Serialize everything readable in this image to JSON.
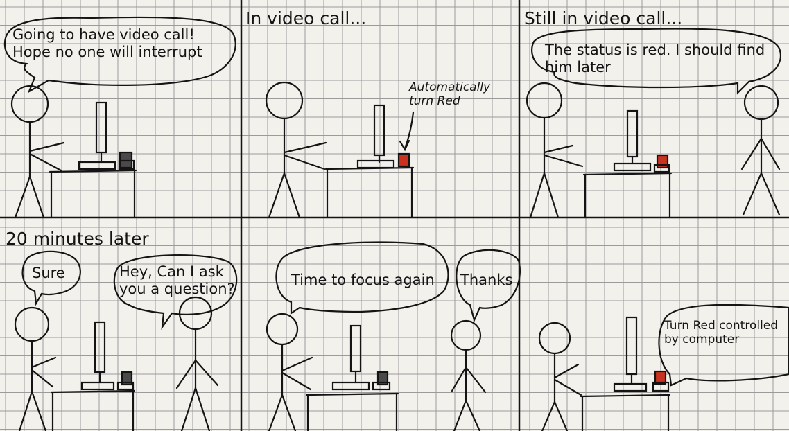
{
  "comic": {
    "panels": [
      {
        "caption": "",
        "bubbles": [
          "Going to have video call! Hope no one will interrupt"
        ],
        "status_light": "off"
      },
      {
        "caption": "In video call...",
        "bubbles": [],
        "annotation": "Automatically turn Red",
        "status_light": "red"
      },
      {
        "caption": "Still in video call...",
        "bubbles": [
          "The status is red. I should find him later"
        ],
        "status_light": "red"
      },
      {
        "caption": "20 minutes later",
        "bubbles": [
          "Sure",
          "Hey, Can I ask you a question?"
        ],
        "status_light": "off"
      },
      {
        "caption": "",
        "bubbles": [
          "Time to focus again",
          "Thanks"
        ],
        "status_light": "off"
      },
      {
        "caption": "",
        "bubbles": [
          "Turn Red controlled by computer"
        ],
        "status_light": "red"
      }
    ]
  },
  "colors": {
    "paper": "#f3f1ec",
    "grid": "#8d8d8d",
    "ink": "#141414",
    "status_red": "#c8321f",
    "status_off": "#4a4a4a"
  }
}
